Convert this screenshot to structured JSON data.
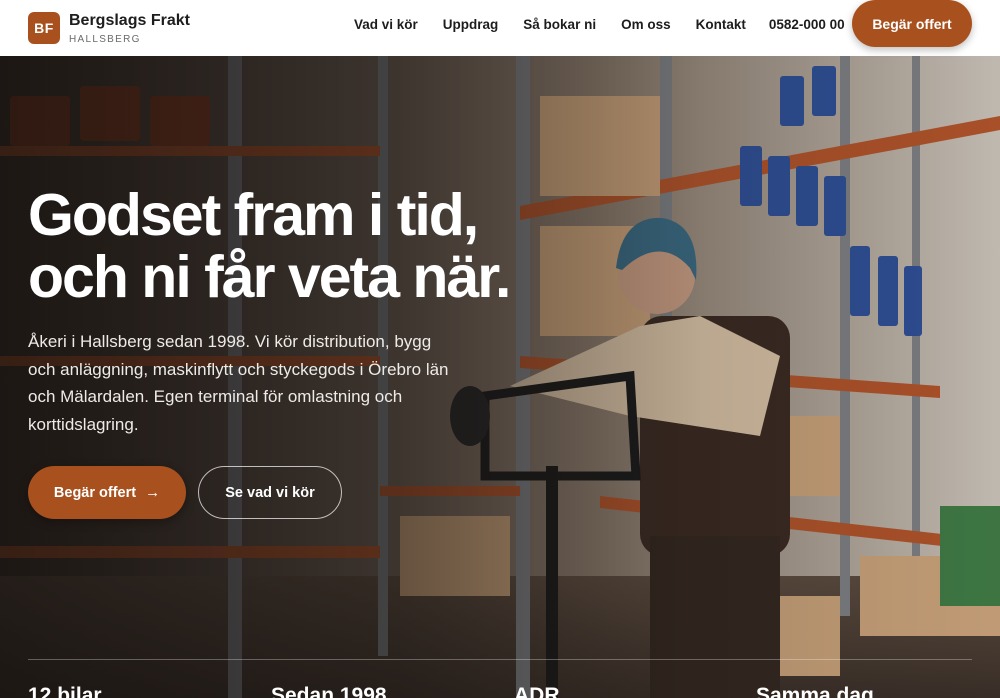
{
  "header": {
    "logo_initials": "BF",
    "brand_name": "Bergslags Frakt",
    "brand_location": "HALLSBERG",
    "nav": [
      "Vad vi kör",
      "Uppdrag",
      "Så bokar ni",
      "Om oss",
      "Kontakt"
    ],
    "phone": "0582-000 00",
    "cta_label": "Begär offert"
  },
  "hero": {
    "title_line1": "Godset fram i tid,",
    "title_line2": "och ni får veta när.",
    "description": "Åkeri i Hallsberg sedan 1998. Vi kör distribution, bygg och anläggning, maskinflytt och styckegods i Örebro län och Mälardalen. Egen terminal för omlastning och korttidslagring.",
    "primary_button": "Begär offert",
    "primary_button_icon": "arrow-right-icon",
    "secondary_button": "Se vad vi kör"
  },
  "stats": [
    "12 bilar",
    "Sedan 1998",
    "ADR",
    "Samma dag"
  ],
  "colors": {
    "accent": "#a8511f",
    "header_bg": "#ffffff",
    "text_dark": "#1d1d1d"
  }
}
